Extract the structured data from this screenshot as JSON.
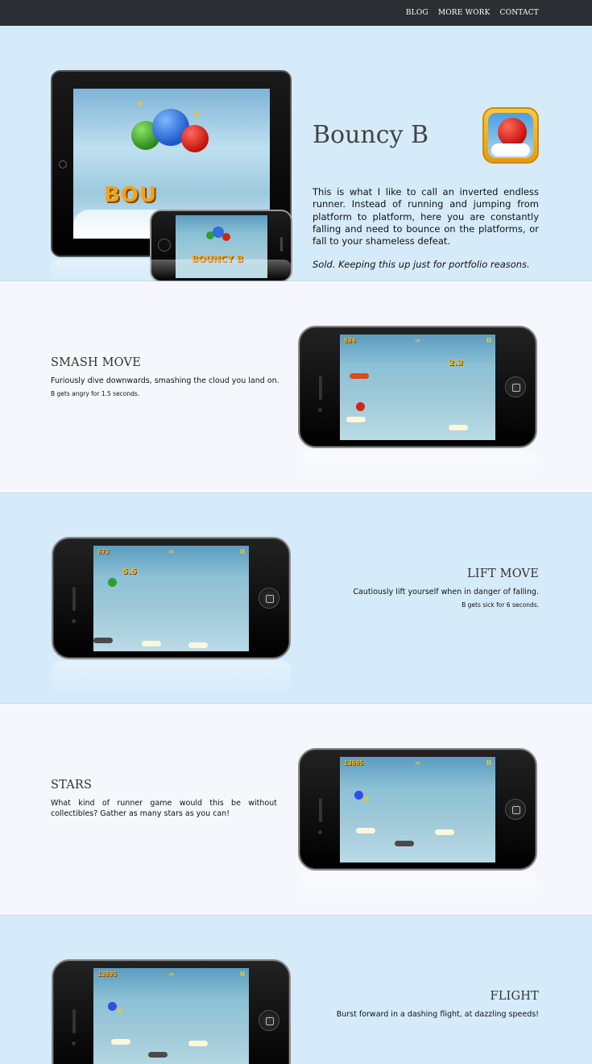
{
  "nav": {
    "blog": "BLOG",
    "more_work": "MORE WORK",
    "contact": "CONTACT"
  },
  "hero": {
    "title": "Bouncy B",
    "description": "This is what I like to call an inverted endless runner. Instead of running and jumping from platform to platform, here you are constantly falling and need to bounce on the platforms, or fall to your shameless defeat.",
    "note": "Sold. Keeping this up just for portfolio reasons.",
    "logo_text": "BOUNCY B"
  },
  "features": {
    "smash": {
      "title": "SMASH MOVE",
      "text": "Furiously dive downwards, smashing the cloud you land on.",
      "sub": "B gets angry for 1.5 seconds.",
      "score": "694",
      "timer": "2.3"
    },
    "lift": {
      "title": "LIFT MOVE",
      "text": "Cautiously lift yourself when in danger of falling.",
      "sub": "B gets sick for 6 seconds.",
      "score": "673",
      "timer": "5.5"
    },
    "stars": {
      "title": "STARS",
      "text": "What kind of runner game would this be without collectibles? Gather as many stars as you can!",
      "score": "13695"
    },
    "flight": {
      "title": "FLIGHT",
      "text": "Burst forward in a dashing flight, at dazzling speeds!",
      "score": "13695"
    }
  },
  "hud": {
    "arrow": "⇒",
    "pause": "II"
  },
  "colors": {
    "topbar": "#2b2f33",
    "blue_section": "#d6ebfa",
    "light_section": "#f6f7fd",
    "hud": "#f7b812"
  }
}
